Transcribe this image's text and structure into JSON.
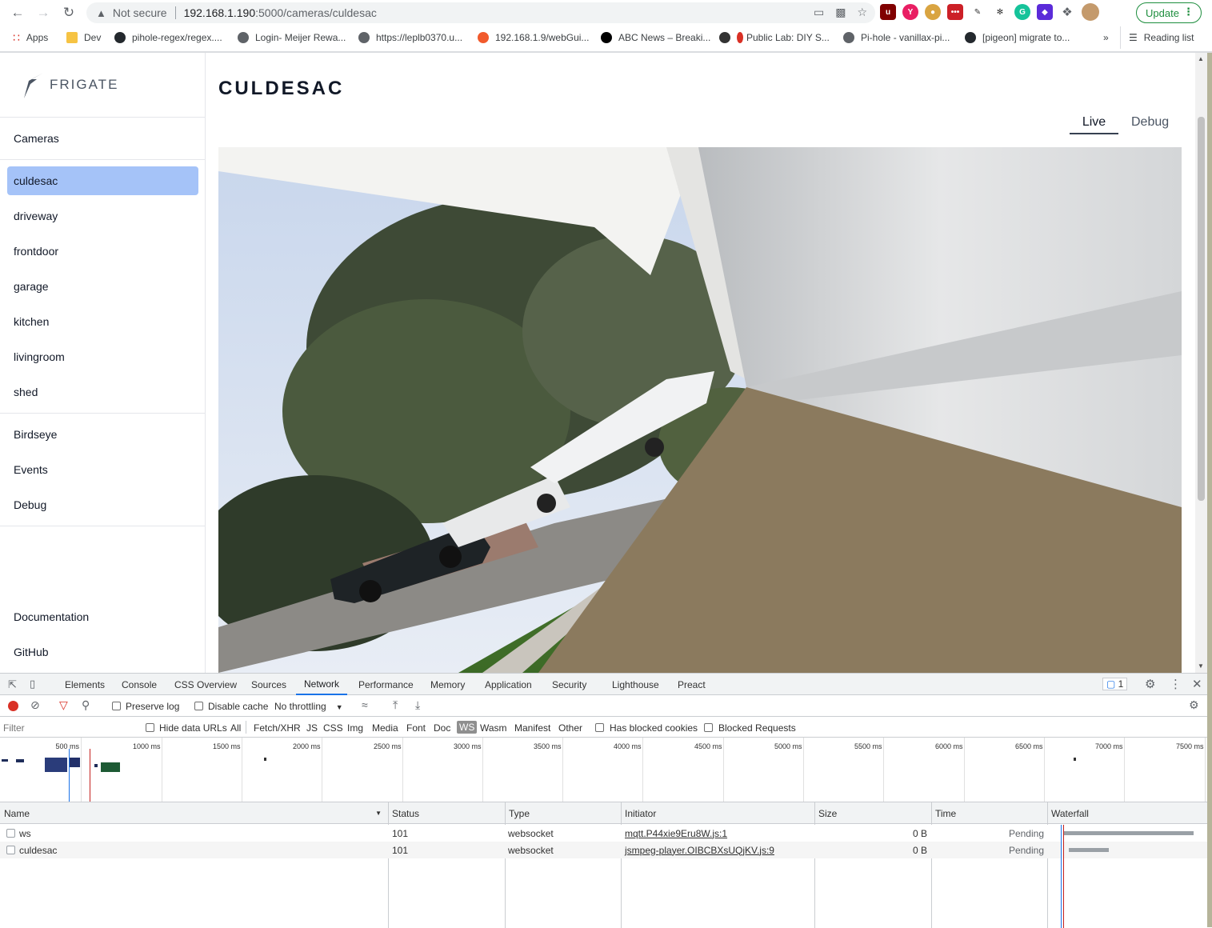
{
  "browser": {
    "security_label": "Not secure",
    "url_host": "192.168.1.190",
    "url_rest": ":5000/cameras/culdesac",
    "update_label": "Update",
    "reading_list_label": "Reading list",
    "bookmarks": [
      {
        "label": "Apps",
        "icon": "apps-grid-icon"
      },
      {
        "label": "Dev",
        "icon": "folder-icon"
      },
      {
        "label": "pihole-regex/regex....",
        "icon": "github-icon"
      },
      {
        "label": "Login- Meijer Rewa...",
        "icon": "globe-icon"
      },
      {
        "label": "https://leplb0370.u...",
        "icon": "globe-icon"
      },
      {
        "label": "192.168.1.9/webGui...",
        "icon": "unraid-icon"
      },
      {
        "label": "ABC News – Breaki...",
        "icon": "abc-icon"
      },
      {
        "label": "Public Lab: DIY S...",
        "icon": "publiclab-icon"
      },
      {
        "label": "Pi-hole - vanillax-pi...",
        "icon": "globe-icon"
      },
      {
        "label": "[pigeon] migrate to...",
        "icon": "github-icon"
      }
    ]
  },
  "frigate": {
    "brand": "FRIGATE",
    "nav_cameras": "Cameras",
    "cameras": [
      "culdesac",
      "driveway",
      "frontdoor",
      "garage",
      "kitchen",
      "livingroom",
      "shed"
    ],
    "active_camera": "culdesac",
    "nav_secondary": [
      "Birdseye",
      "Events",
      "Debug"
    ],
    "nav_footer": [
      "Documentation",
      "GitHub"
    ],
    "page_title": "CULDESAC",
    "tabs": [
      "Live",
      "Debug"
    ],
    "active_tab": "Live"
  },
  "devtools": {
    "tabs": [
      "Elements",
      "Console",
      "CSS Overview",
      "Sources",
      "Network",
      "Performance",
      "Memory",
      "Application",
      "Security",
      "Lighthouse",
      "Preact"
    ],
    "active_tab": "Network",
    "issues_count": "1",
    "toolbar": {
      "preserve_log": "Preserve log",
      "disable_cache": "Disable cache",
      "throttling": "No throttling"
    },
    "filter": {
      "placeholder": "Filter",
      "hide_data_urls": "Hide data URLs",
      "types": [
        "All",
        "Fetch/XHR",
        "JS",
        "CSS",
        "Img",
        "Media",
        "Font",
        "Doc",
        "WS",
        "Wasm",
        "Manifest",
        "Other"
      ],
      "active_type": "WS",
      "has_blocked_cookies": "Has blocked cookies",
      "blocked_requests": "Blocked Requests"
    },
    "timeline_ticks": [
      "500 ms",
      "1000 ms",
      "1500 ms",
      "2000 ms",
      "2500 ms",
      "3000 ms",
      "3500 ms",
      "4000 ms",
      "4500 ms",
      "5000 ms",
      "5500 ms",
      "6000 ms",
      "6500 ms",
      "7000 ms",
      "7500 ms"
    ],
    "columns": [
      "Name",
      "Status",
      "Type",
      "Initiator",
      "Size",
      "Time",
      "Waterfall"
    ],
    "rows": [
      {
        "name": "ws",
        "status": "101",
        "type": "websocket",
        "initiator": "mqtt.P44xie9Eru8W.js:1",
        "size": "0 B",
        "time": "Pending"
      },
      {
        "name": "culdesac",
        "status": "101",
        "type": "websocket",
        "initiator": "jsmpeg-player.OIBCBXsUQjKV.js:9",
        "size": "0 B",
        "time": "Pending"
      }
    ]
  },
  "colors": {
    "active_nav_bg": "#a5c3f8",
    "devtools_accent": "#1a73e8",
    "update_green": "#1e8e3e"
  }
}
